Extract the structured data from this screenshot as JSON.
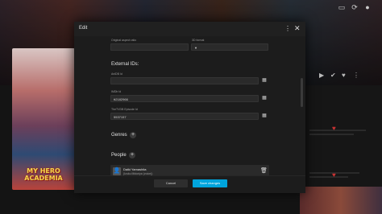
{
  "topbar": {
    "icons": [
      "cast-icon",
      "sync-icon",
      "user-icon"
    ]
  },
  "poster": {
    "logo_text": "MY HERO ACADEMIA"
  },
  "background": {
    "action_icons": [
      "play-icon",
      "check-icon",
      "heart-icon",
      "more-icon"
    ]
  },
  "dialog": {
    "title": "Edit",
    "menu_glyph": "⋮",
    "close_glyph": "✕",
    "fields": {
      "original_aspect_ratio_label": "Original aspect ratio",
      "original_aspect_ratio_value": "",
      "s3d_format_label": "3D format",
      "s3d_format_value": ""
    },
    "external_ids": {
      "title": "External IDs:",
      "anidb_label": "AniDB Id",
      "anidb_value": "",
      "imdb_label": "IMDb Id",
      "imdb_value": "tt2182966",
      "tvdb_label": "TheTVDB Episode Id",
      "tvdb_value": "5537157"
    },
    "genres_title": "Genres",
    "people_title": "People",
    "person": {
      "name": "Daiki Yamashita",
      "role": "(Izuku Midoriya (voice))"
    },
    "footer": {
      "cancel_label": "Cancel",
      "save_label": "Save changes"
    }
  }
}
